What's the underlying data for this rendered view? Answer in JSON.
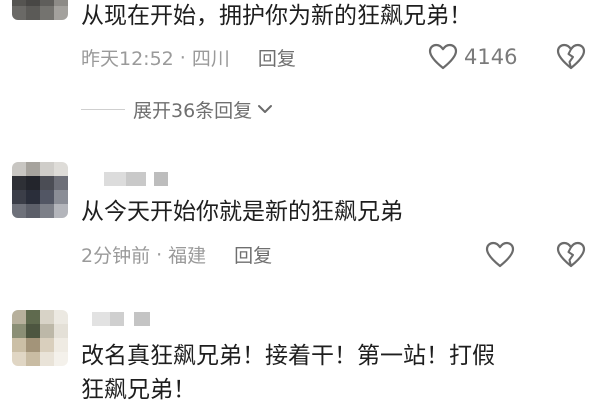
{
  "comments": [
    {
      "text": "从现在开始，拥护你为新的狂飙兄弟！",
      "time": "昨天12:52",
      "location": "四川",
      "reply_label": "回复",
      "like_count": "4146",
      "expand_label": "展开36条回复"
    },
    {
      "text": "从今天开始你就是新的狂飙兄弟",
      "time": "2分钟前",
      "location": "福建",
      "reply_label": "回复"
    },
    {
      "text_line1": "改名真狂飙兄弟！接着干！第一站！打假",
      "text_line2": "狂飙兄弟！"
    }
  ],
  "meta_separator": "·",
  "icons": {
    "like": "heart-outline-icon",
    "dislike": "broken-heart-icon",
    "expand": "chevron-down-icon"
  },
  "colors": {
    "text": "#1e1e1e",
    "meta": "#9a9a9a",
    "icon": "#6b6b6b"
  }
}
